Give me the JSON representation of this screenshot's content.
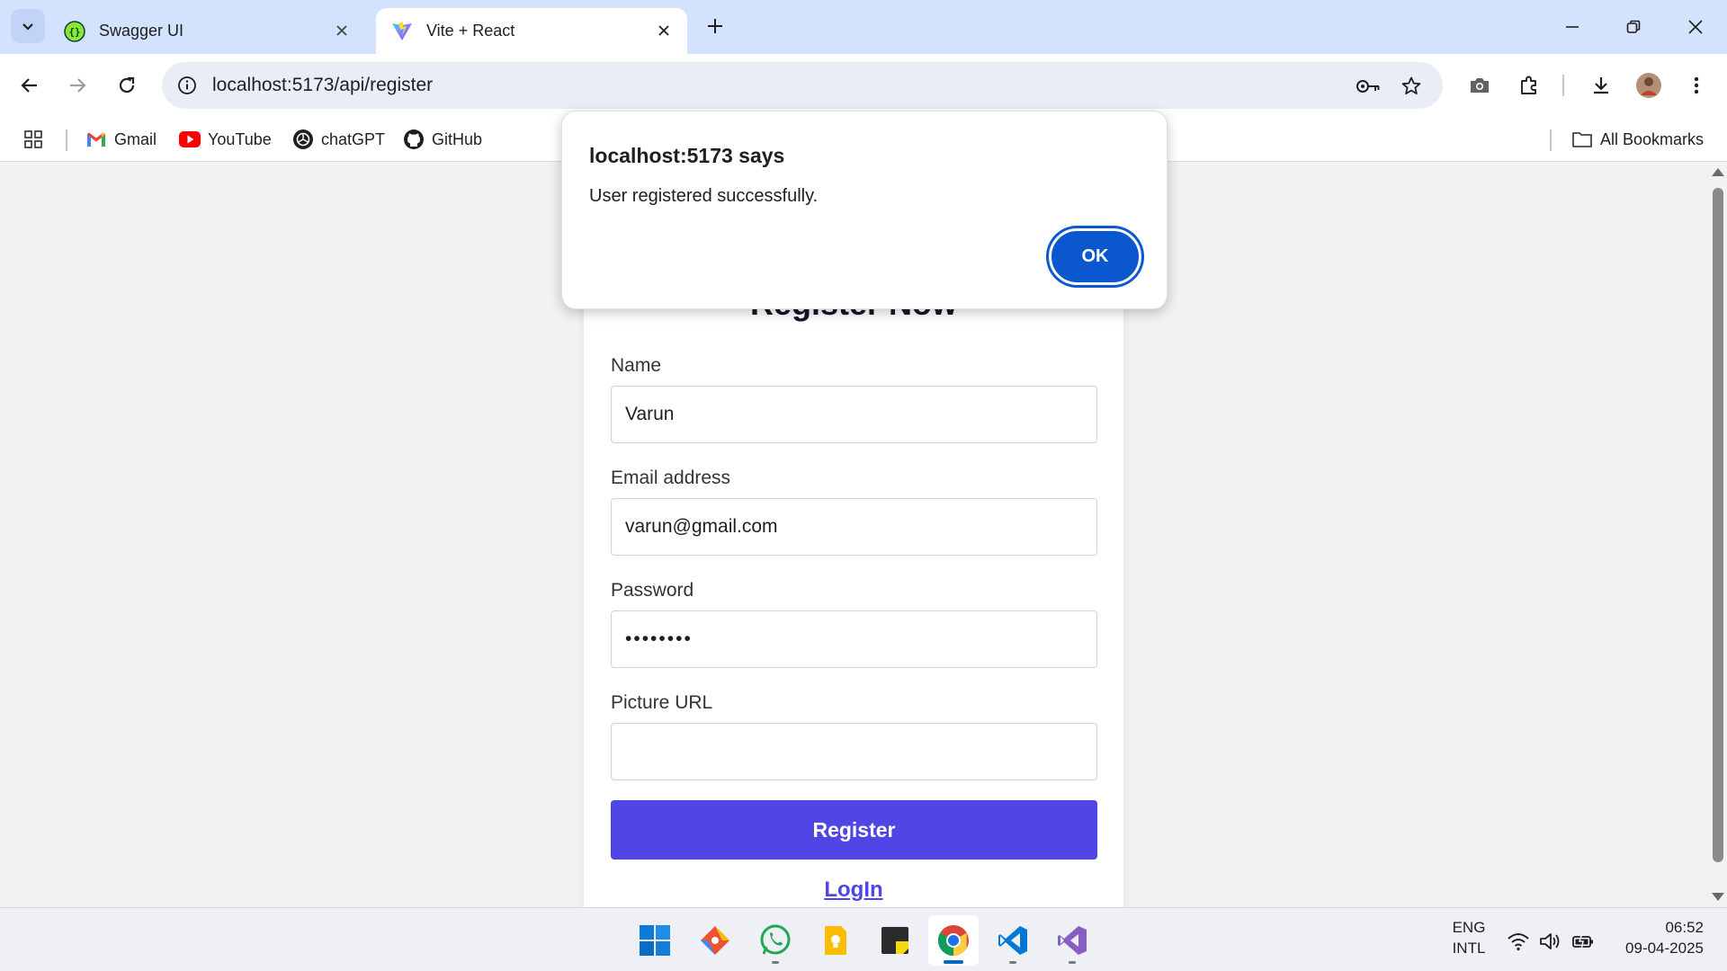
{
  "browser": {
    "tabs": [
      {
        "title": "Swagger UI",
        "active": false
      },
      {
        "title": "Vite + React",
        "active": true
      }
    ],
    "address_bar": {
      "url": "localhost:5173/api/register"
    },
    "bookmarks": [
      {
        "label": "Gmail",
        "icon": "gmail-icon"
      },
      {
        "label": "YouTube",
        "icon": "youtube-icon"
      },
      {
        "label": "chatGPT",
        "icon": "chatgpt-icon"
      },
      {
        "label": "GitHub",
        "icon": "github-icon"
      }
    ],
    "all_bookmarks_label": "All Bookmarks"
  },
  "alert": {
    "title": "localhost:5173 says",
    "message": "User registered successfully.",
    "ok_label": "OK"
  },
  "form": {
    "heading": "Register Now",
    "fields": [
      {
        "label": "Name",
        "value": "Varun",
        "type": "text"
      },
      {
        "label": "Email address",
        "value": "varun@gmail.com",
        "type": "email"
      },
      {
        "label": "Password",
        "value": "varun123",
        "type": "password"
      },
      {
        "label": "Picture URL",
        "value": "",
        "type": "text"
      }
    ],
    "submit_label": "Register",
    "login_link": "LogIn"
  },
  "taskbar": {
    "language": "ENG",
    "layout": "INTL",
    "time": "06:52",
    "date": "09-04-2025"
  },
  "colors": {
    "accent": "#4f46e5",
    "dialog_button": "#0b57d0",
    "tab_strip": "#d3e3fd"
  }
}
